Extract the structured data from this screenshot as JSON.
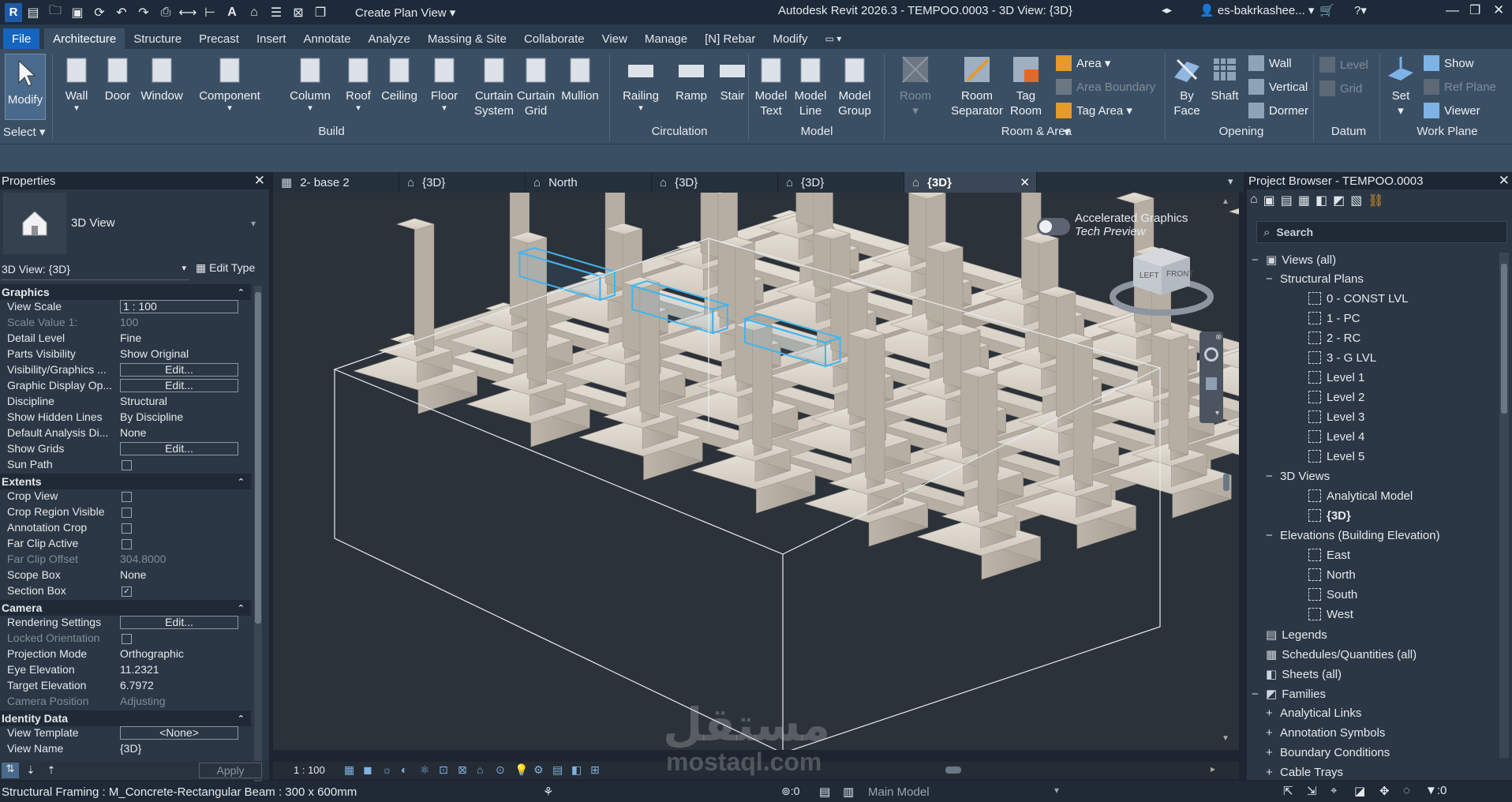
{
  "titlebar": {
    "plan_dropdown": "Create Plan View",
    "title": "Autodesk Revit 2026.3 - TEMPOO.0003 - 3D View: {3D}",
    "user": "es-bakrkashee..."
  },
  "menu": [
    "File",
    "Architecture",
    "Structure",
    "Precast",
    "Insert",
    "Annotate",
    "Analyze",
    "Massing & Site",
    "Collaborate",
    "View",
    "Manage",
    "[N] Rebar",
    "Modify"
  ],
  "ribbon": {
    "modify": "Modify",
    "select": "Select",
    "build": [
      {
        "l": "Wall",
        "l2": ""
      },
      {
        "l": "Door",
        "l2": ""
      },
      {
        "l": "Window",
        "l2": ""
      },
      {
        "l": "Component",
        "l2": ""
      },
      {
        "l": "Column",
        "l2": ""
      },
      {
        "l": "Roof",
        "l2": ""
      },
      {
        "l": "Ceiling",
        "l2": ""
      },
      {
        "l": "Floor",
        "l2": ""
      },
      {
        "l": "Curtain",
        "l2": "System"
      },
      {
        "l": "Curtain",
        "l2": "Grid"
      },
      {
        "l": "Mullion",
        "l2": ""
      }
    ],
    "build_label": "Build",
    "circulation": [
      {
        "l": "Railing"
      },
      {
        "l": "Ramp"
      },
      {
        "l": "Stair"
      }
    ],
    "circulation_label": "Circulation",
    "model": [
      {
        "l": "Model",
        "l2": "Text"
      },
      {
        "l": "Model",
        "l2": "Line"
      },
      {
        "l": "Model",
        "l2": "Group"
      }
    ],
    "model_label": "Model",
    "room": {
      "room": "Room",
      "separator1": "Room",
      "separator2": "Separator",
      "tag1": "Tag",
      "tag2": "Room",
      "area": "Area",
      "area_boundary": "Area  Boundary",
      "tag_area": "Tag   Area",
      "label": "Room & Area"
    },
    "opening": {
      "byface1": "By",
      "byface2": "Face",
      "shaft": "Shaft",
      "wall": "Wall",
      "vertical": "Vertical",
      "dormer": "Dormer",
      "label": "Opening"
    },
    "datum": {
      "level": "Level",
      "grid": "Grid",
      "label": "Datum"
    },
    "workplane": {
      "set": "Set",
      "show": "Show",
      "refplane": "Ref  Plane",
      "viewer": "Viewer",
      "label": "Work Plane"
    }
  },
  "properties": {
    "title": "Properties",
    "type": "3D View",
    "instance": "3D View: {3D}",
    "edit_type": "Edit Type",
    "sections": {
      "graphics": "Graphics",
      "extents": "Extents",
      "camera": "Camera",
      "identity": "Identity Data"
    },
    "graphics": [
      {
        "k": "View Scale",
        "v": "1 : 100",
        "box": "input"
      },
      {
        "k": "Scale Value    1:",
        "v": "100",
        "dim": true
      },
      {
        "k": "Detail Level",
        "v": "Fine"
      },
      {
        "k": "Parts Visibility",
        "v": "Show Original"
      },
      {
        "k": "Visibility/Graphics ...",
        "v": "Edit...",
        "box": "edit"
      },
      {
        "k": "Graphic Display Op...",
        "v": "Edit...",
        "box": "edit"
      },
      {
        "k": "Discipline",
        "v": "Structural"
      },
      {
        "k": "Show Hidden Lines",
        "v": "By Discipline"
      },
      {
        "k": "Default Analysis Di...",
        "v": "None"
      },
      {
        "k": "Show Grids",
        "v": "Edit...",
        "box": "edit"
      },
      {
        "k": "Sun Path",
        "v": "",
        "box": "chk"
      }
    ],
    "extents": [
      {
        "k": "Crop View",
        "v": "",
        "box": "chk"
      },
      {
        "k": "Crop Region Visible",
        "v": "",
        "box": "chk"
      },
      {
        "k": "Annotation Crop",
        "v": "",
        "box": "chk"
      },
      {
        "k": "Far Clip Active",
        "v": "",
        "box": "chk"
      },
      {
        "k": "Far Clip Offset",
        "v": "304.8000",
        "dim": true
      },
      {
        "k": "Scope Box",
        "v": "None"
      },
      {
        "k": "Section Box",
        "v": "✓",
        "box": "chkon"
      }
    ],
    "camera": [
      {
        "k": "Rendering Settings",
        "v": "Edit...",
        "box": "edit"
      },
      {
        "k": "Locked Orientation",
        "v": "",
        "box": "chk",
        "dim": true
      },
      {
        "k": "Projection Mode",
        "v": "Orthographic"
      },
      {
        "k": "Eye Elevation",
        "v": "11.2321"
      },
      {
        "k": "Target Elevation",
        "v": "6.7972"
      },
      {
        "k": "Camera Position",
        "v": "Adjusting",
        "dim": true
      }
    ],
    "identity": [
      {
        "k": "View Template",
        "v": "<None>",
        "box": "edit"
      },
      {
        "k": "View Name",
        "v": "{3D}"
      }
    ],
    "apply": "Apply"
  },
  "tabs": [
    {
      "label": "2- base 2",
      "icon": "plan"
    },
    {
      "label": "{3D}",
      "icon": "house"
    },
    {
      "label": "North",
      "icon": "elev"
    },
    {
      "label": "{3D}",
      "icon": "house"
    },
    {
      "label": "{3D}",
      "icon": "house"
    },
    {
      "label": "{3D}",
      "icon": "house",
      "active": true
    }
  ],
  "canvas": {
    "accel1": "Accelerated Graphics",
    "accel2": "Tech Preview",
    "cube_left": "LEFT",
    "cube_front": "FRONT"
  },
  "viewbar": {
    "scale": "1 : 100"
  },
  "browser": {
    "title": "Project Browser - TEMPOO.0003",
    "search": "Search",
    "items": [
      {
        "t": "Views (all)",
        "lvl": 0,
        "sign": "−",
        "icon": "views"
      },
      {
        "t": "Structural Plans",
        "lvl": 1,
        "sign": "−"
      },
      {
        "t": "0 - CONST LVL",
        "lvl": 2
      },
      {
        "t": "1 - PC",
        "lvl": 2
      },
      {
        "t": "2 - RC",
        "lvl": 2
      },
      {
        "t": "3 - G LVL",
        "lvl": 2
      },
      {
        "t": "Level 1",
        "lvl": 2
      },
      {
        "t": "Level 2",
        "lvl": 2
      },
      {
        "t": "Level 3",
        "lvl": 2
      },
      {
        "t": "Level 4",
        "lvl": 2
      },
      {
        "t": "Level 5",
        "lvl": 2
      },
      {
        "t": "3D Views",
        "lvl": 1,
        "sign": "−"
      },
      {
        "t": "Analytical Model",
        "lvl": 2
      },
      {
        "t": "{3D}",
        "lvl": 2,
        "bold": true
      },
      {
        "t": "Elevations (Building Elevation)",
        "lvl": 1,
        "sign": "−"
      },
      {
        "t": "East",
        "lvl": 2
      },
      {
        "t": "North",
        "lvl": 2
      },
      {
        "t": "South",
        "lvl": 2
      },
      {
        "t": "West",
        "lvl": 2
      },
      {
        "t": "Legends",
        "lvl": 0,
        "icon": "legend"
      },
      {
        "t": "Schedules/Quantities (all)",
        "lvl": 0,
        "icon": "sched"
      },
      {
        "t": "Sheets (all)",
        "lvl": 0,
        "icon": "sheet"
      },
      {
        "t": "Families",
        "lvl": 0,
        "sign": "−",
        "icon": "family"
      },
      {
        "t": "Analytical Links",
        "lvl": 1,
        "sign": "+"
      },
      {
        "t": "Annotation Symbols",
        "lvl": 1,
        "sign": "+"
      },
      {
        "t": "Boundary Conditions",
        "lvl": 1,
        "sign": "+"
      },
      {
        "t": "Cable Trays",
        "lvl": 1,
        "sign": "+"
      }
    ]
  },
  "status": {
    "text": "Structural Framing : M_Concrete-Rectangular Beam : 300 x 600mm",
    "zero": ":0",
    "model": "Main Model",
    "filter": ":0"
  },
  "watermark": {
    "ar": "مستقل",
    "en": "mostaql.com"
  }
}
